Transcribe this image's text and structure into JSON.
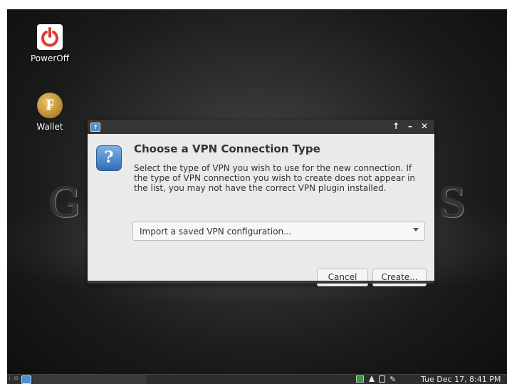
{
  "desktop": {
    "icons": [
      {
        "label": "PowerOff",
        "icon": "power-icon",
        "color": "#e03a2f"
      },
      {
        "label": "Wallet",
        "icon": "wallet-icon",
        "color": "#c9973a"
      }
    ],
    "wallpaper_letters": [
      "G",
      "S"
    ]
  },
  "dialog": {
    "titlebar_icon": "network-manager-icon",
    "controls": {
      "maximize": "↑",
      "minimize": "–",
      "close": "✕"
    },
    "heading": "Choose a VPN Connection Type",
    "description": "Select the type of VPN you wish to use for the new connection. If the type of VPN connection you wish to create does not appear in the list, you may not have the correct VPN plugin installed.",
    "vpn_type_selected": "Import a saved VPN configuration...",
    "buttons": {
      "cancel": "Cancel",
      "create": "Create..."
    }
  },
  "taskbar": {
    "menu": "⁞ ≡",
    "tray_icons": [
      "network-status-icon",
      "notification-bell-icon",
      "battery-icon",
      "brush-icon"
    ],
    "clock": "Tue Dec 17, 8:41 PM"
  },
  "colors": {
    "titlebar": "#353535",
    "dialog_bg": "#eaeaea",
    "accent_blue": "#4d8fd1"
  }
}
